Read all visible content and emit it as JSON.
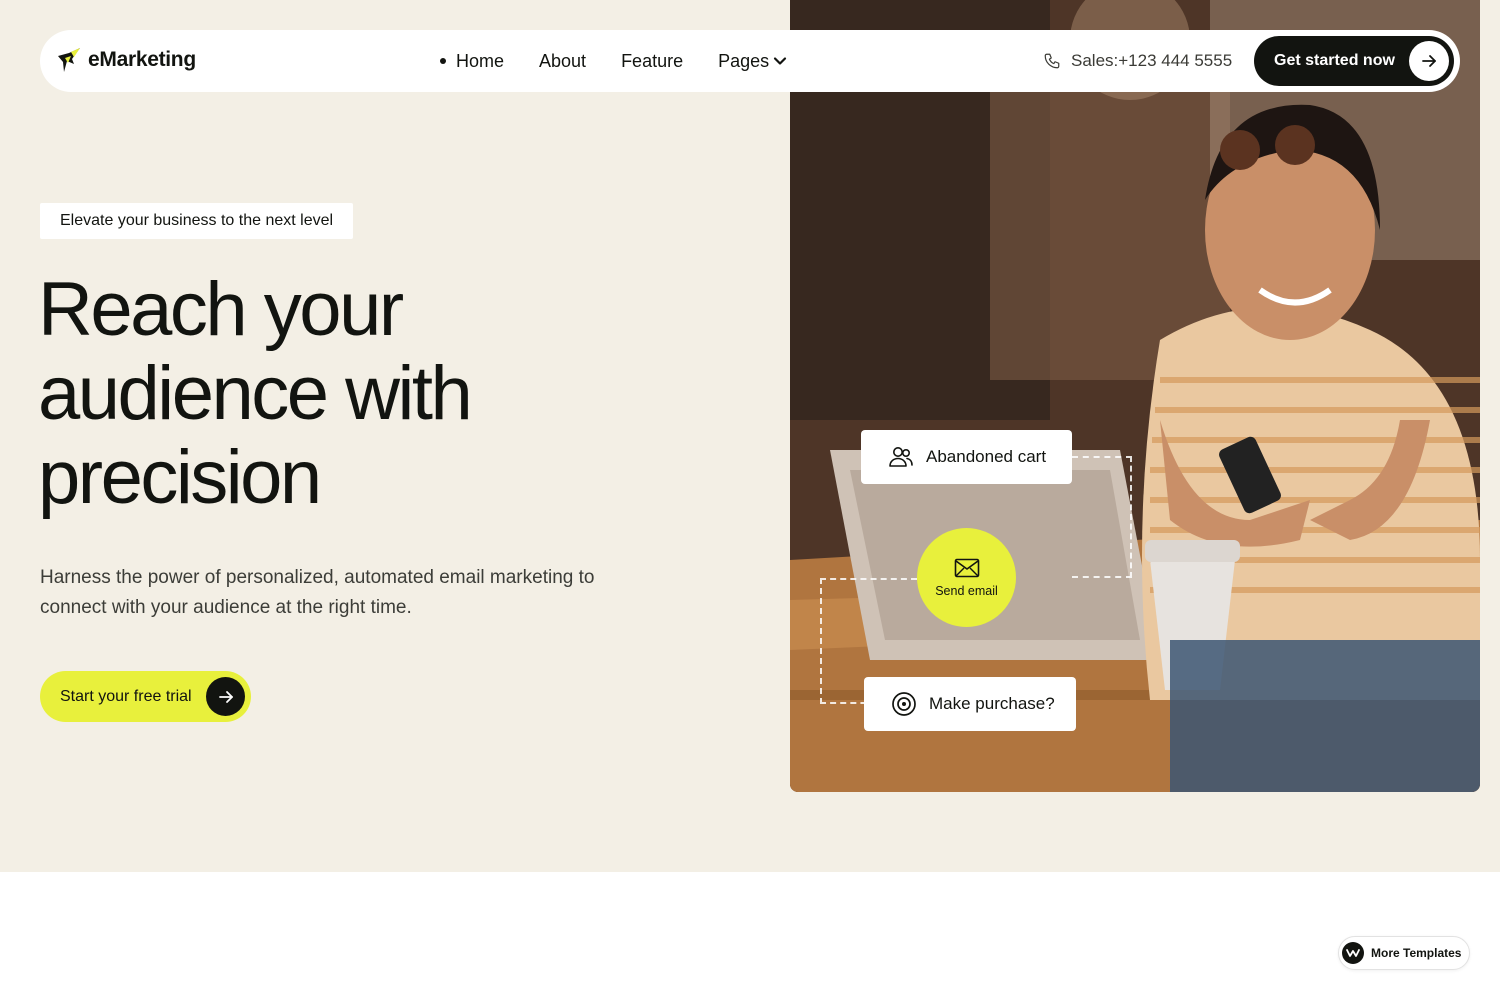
{
  "brand": {
    "name": "eMarketing",
    "logo_icon": "bird-logo-icon",
    "accent": "#e8f03c"
  },
  "nav": {
    "links": [
      "Home",
      "About",
      "Feature",
      "Pages"
    ],
    "active": "Home",
    "sales_text": "Sales:+123 444 5555",
    "cta_label": "Get started now"
  },
  "hero": {
    "tagline": "Elevate your business to the next level",
    "headline_lines": [
      "Reach your",
      "audience with",
      "precision"
    ],
    "subcopy": "Harness the power of personalized, automated email marketing to connect with your audience at the right time.",
    "cta_label": "Start your free trial"
  },
  "workflow": {
    "step1": {
      "label": "Abandoned cart",
      "icon": "users-icon"
    },
    "step2": {
      "label": "Send email",
      "icon": "envelope-icon"
    },
    "step3": {
      "label": "Make purchase?",
      "icon": "target-icon"
    }
  },
  "badge": {
    "label": "More Templates"
  },
  "colors": {
    "hero_bg": "#f3efe5",
    "dark": "#121410",
    "accent": "#e8f03c",
    "white": "#ffffff"
  }
}
